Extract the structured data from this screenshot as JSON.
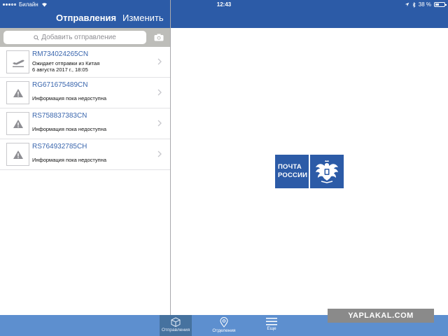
{
  "status_bar": {
    "carrier": "Билайн",
    "time": "12:43",
    "battery": "38 %"
  },
  "nav": {
    "title": "Отправления",
    "edit_label": "Изменить"
  },
  "search": {
    "placeholder": "Добавить отправление"
  },
  "shipments": [
    {
      "tracking": "RM734024265CN",
      "status": "Ожидает отправки из Китая",
      "date": "6 августа 2017 г., 18:05",
      "icon": "airplane-departure-icon"
    },
    {
      "tracking": "RG671675489CN",
      "status": "Информация пока недоступна",
      "icon": "warning-icon"
    },
    {
      "tracking": "RS758837383CN",
      "status": "Информация пока недоступна",
      "icon": "warning-icon"
    },
    {
      "tracking": "RS764932785CH",
      "status": "Информация пока недоступна",
      "icon": "warning-icon"
    }
  ],
  "logo": {
    "line1": "ПОЧТА",
    "line2": "РОССИИ"
  },
  "tabs": [
    {
      "label": "Отправления",
      "icon": "package-icon",
      "active": true
    },
    {
      "label": "Отделения",
      "icon": "map-pin-icon",
      "active": false
    },
    {
      "label": "Еще",
      "icon": "menu-icon",
      "active": false
    }
  ],
  "watermark": "YAPLAKAL.COM",
  "colors": {
    "brand_blue": "#2c5ba7",
    "tabbar_blue": "#5d8fcf",
    "link_blue": "#3a66ad"
  }
}
